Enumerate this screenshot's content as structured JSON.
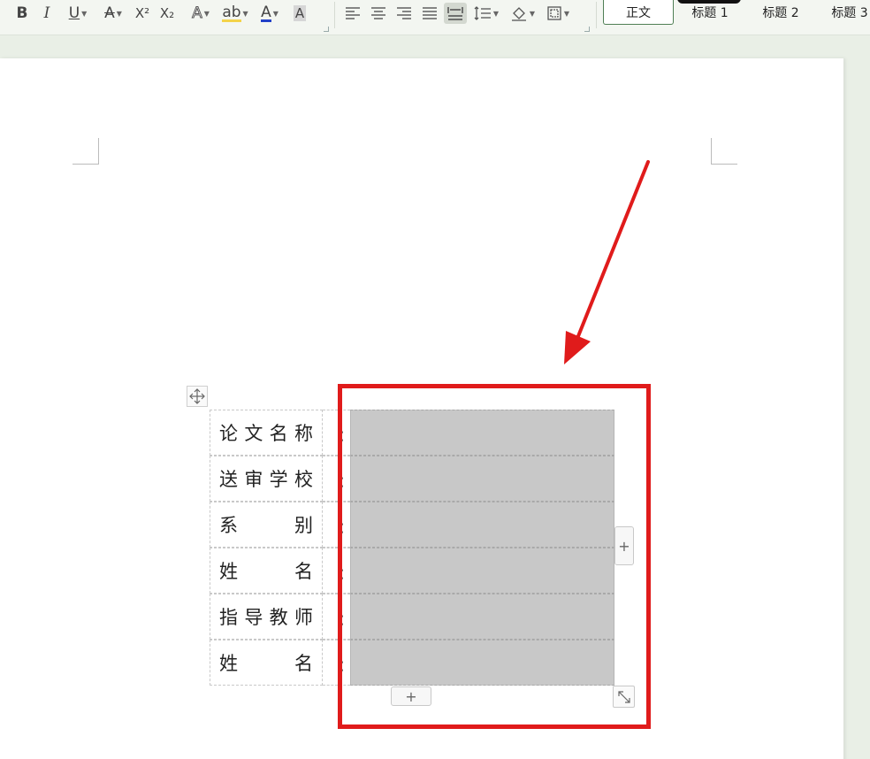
{
  "toolbar": {
    "bold": "B",
    "italic": "I",
    "underline": "U",
    "strikethrough": "A",
    "superscript": "X²",
    "subscript": "X₂",
    "text_effect": "A",
    "highlight": "ab",
    "font_color": "A",
    "char_shading": "A",
    "styles": {
      "normal": "正文",
      "heading1": "标题 1",
      "heading2": "标题 2",
      "heading3": "标题 3"
    }
  },
  "table": {
    "rows": [
      {
        "label": [
          "论",
          "文",
          "名",
          "称"
        ],
        "colon": "："
      },
      {
        "label": [
          "送",
          "审",
          "学",
          "校"
        ],
        "colon": "："
      },
      {
        "label": [
          "系",
          "别"
        ],
        "colon": "："
      },
      {
        "label": [
          "姓",
          "名"
        ],
        "colon": "："
      },
      {
        "label": [
          "指",
          "导",
          "教",
          "师"
        ],
        "colon": "："
      },
      {
        "label": [
          "姓",
          "名"
        ],
        "colon": "："
      }
    ],
    "add_col": "+",
    "add_row": "+"
  },
  "colors": {
    "annotation": "#e01b1b",
    "selection": "#c8c8c8",
    "accent": "#4f7f55"
  },
  "icons": [
    "bold-icon",
    "italic-icon",
    "underline-icon",
    "strikethrough-icon",
    "superscript-icon",
    "subscript-icon",
    "text-effect-icon",
    "highlight-icon",
    "font-color-icon",
    "char-shading-icon",
    "align-left-icon",
    "align-center-icon",
    "align-right-icon",
    "justify-icon",
    "distributed-icon",
    "line-spacing-icon",
    "shading-icon",
    "border-icon",
    "table-move-icon",
    "table-resize-icon"
  ]
}
